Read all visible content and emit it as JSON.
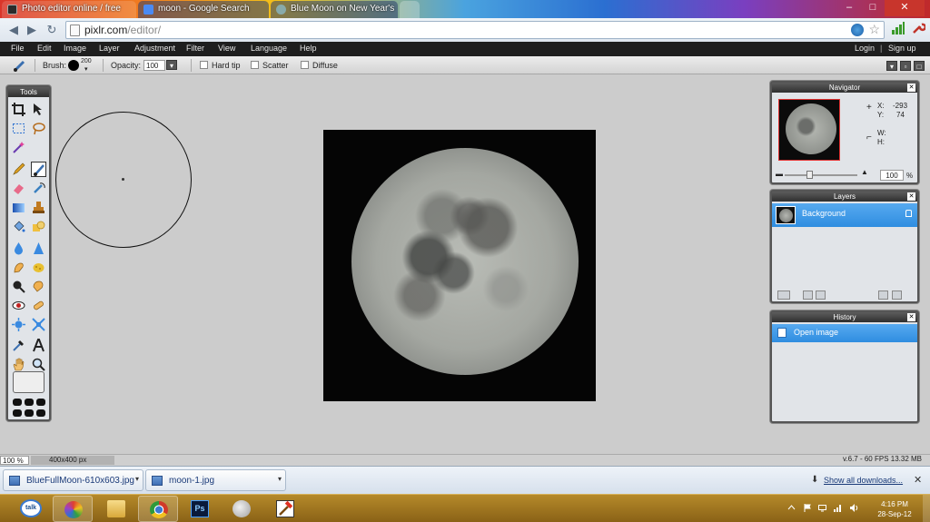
{
  "browser": {
    "tabs": [
      {
        "title": "Photo editor online / free"
      },
      {
        "title": "moon - Google Search"
      },
      {
        "title": "Blue Moon on New Year's"
      }
    ],
    "window_controls": [
      "–",
      "□",
      "✕"
    ],
    "url_host": "pixlr.com",
    "url_path": "/editor/",
    "nav": {
      "back": "◀",
      "forward": "▶",
      "reload": "↻"
    }
  },
  "app": {
    "menu": [
      "File",
      "Edit",
      "Image",
      "Layer",
      "Adjustment",
      "Filter",
      "View",
      "Language",
      "Help"
    ],
    "login": "Login",
    "signup": "Sign up",
    "divider": "|",
    "options": {
      "brush_label": "Brush:",
      "brush_size": "200",
      "opacity_label": "Opacity:",
      "opacity_value": "100",
      "dropdown_arrow": "▾",
      "hard_tip": "Hard tip",
      "scatter": "Scatter",
      "diffuse": "Diffuse"
    },
    "tools_title": "Tools",
    "navigator": {
      "title": "Navigator",
      "x_label": "X:",
      "x_value": "-293",
      "y_label": "Y:",
      "y_value": "74",
      "w_label": "W:",
      "h_label": "H:",
      "zoom": "100",
      "zoom_unit": "%"
    },
    "layers": {
      "title": "Layers",
      "items": [
        {
          "name": "Background"
        }
      ]
    },
    "history": {
      "title": "History",
      "items": [
        {
          "name": "Open image"
        }
      ]
    },
    "panel_close": "✕",
    "status": {
      "zoom": "100 %",
      "size": "400x400 px",
      "version": "v.6.7 - 60 FPS 13.32 MB"
    }
  },
  "downloads": {
    "items": [
      {
        "name": "BlueFullMoon-610x603.jpg"
      },
      {
        "name": "moon-1.jpg"
      }
    ],
    "show_all": "Show all downloads...",
    "close": "✕",
    "arrow": "▾",
    "down_icon": "⬇"
  },
  "taskbar": {
    "time": "4:16 PM",
    "date": "28-Sep-12",
    "talk_label": "talk",
    "ps_label": "Ps"
  }
}
